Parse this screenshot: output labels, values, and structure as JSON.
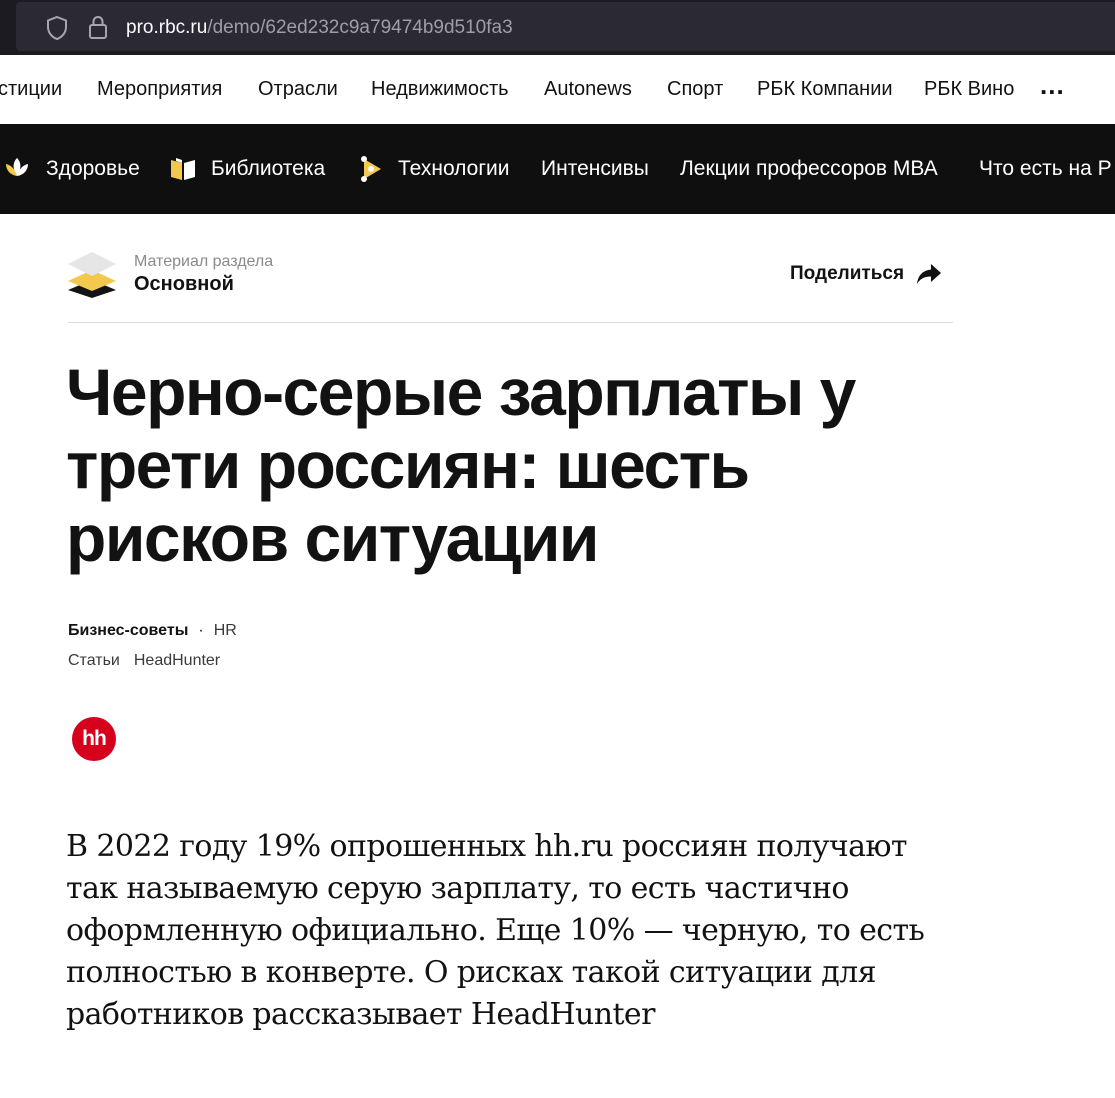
{
  "browser": {
    "url_host": "pro.rbc.ru",
    "url_path": "/demo/62ed232c9a79474b9d510fa3",
    "icons": [
      "shield-icon",
      "lock-icon"
    ]
  },
  "top_nav": {
    "items": [
      "стиции",
      "Мероприятия",
      "Отрасли",
      "Недвижимость",
      "Autonews",
      "Спорт",
      "РБК Компании",
      "РБК Вино"
    ],
    "more_label": "..."
  },
  "dark_nav": {
    "items": [
      {
        "label": "Здоровье",
        "icon": "health-icon"
      },
      {
        "label": "Библиотека",
        "icon": "book-icon"
      },
      {
        "label": "Технологии",
        "icon": "tech-icon"
      },
      {
        "label": "Интенсивы"
      },
      {
        "label": "Лекции профессоров МВА"
      },
      {
        "label": "Что есть на Р"
      }
    ]
  },
  "article": {
    "section_caption": "Материал раздела",
    "section_name": "Основной",
    "share_label": "Поделиться",
    "headline": "Черно-серые зарплаты у трети россиян: шесть рисков ситуации",
    "tag_main": "Бизнес-советы",
    "tag_dot": "·",
    "tag_secondary": "HR",
    "type": "Статьи",
    "author": "HeadHunter",
    "author_logo_text": "hh",
    "lead": "В 2022 году 19% опрошенных hh.ru россиян получают так называемую серую зарплату, то есть частично оформленную официально. Еще 10% — черную, то есть полностью в конверте. О рисках такой ситуации для работников рассказывает HeadHunter"
  },
  "colors": {
    "dark_nav_bg": "#0f0f0f",
    "browser_bg": "#1c1b22",
    "hh_red": "#d6001c",
    "accent_yellow": "#f2c94c"
  }
}
